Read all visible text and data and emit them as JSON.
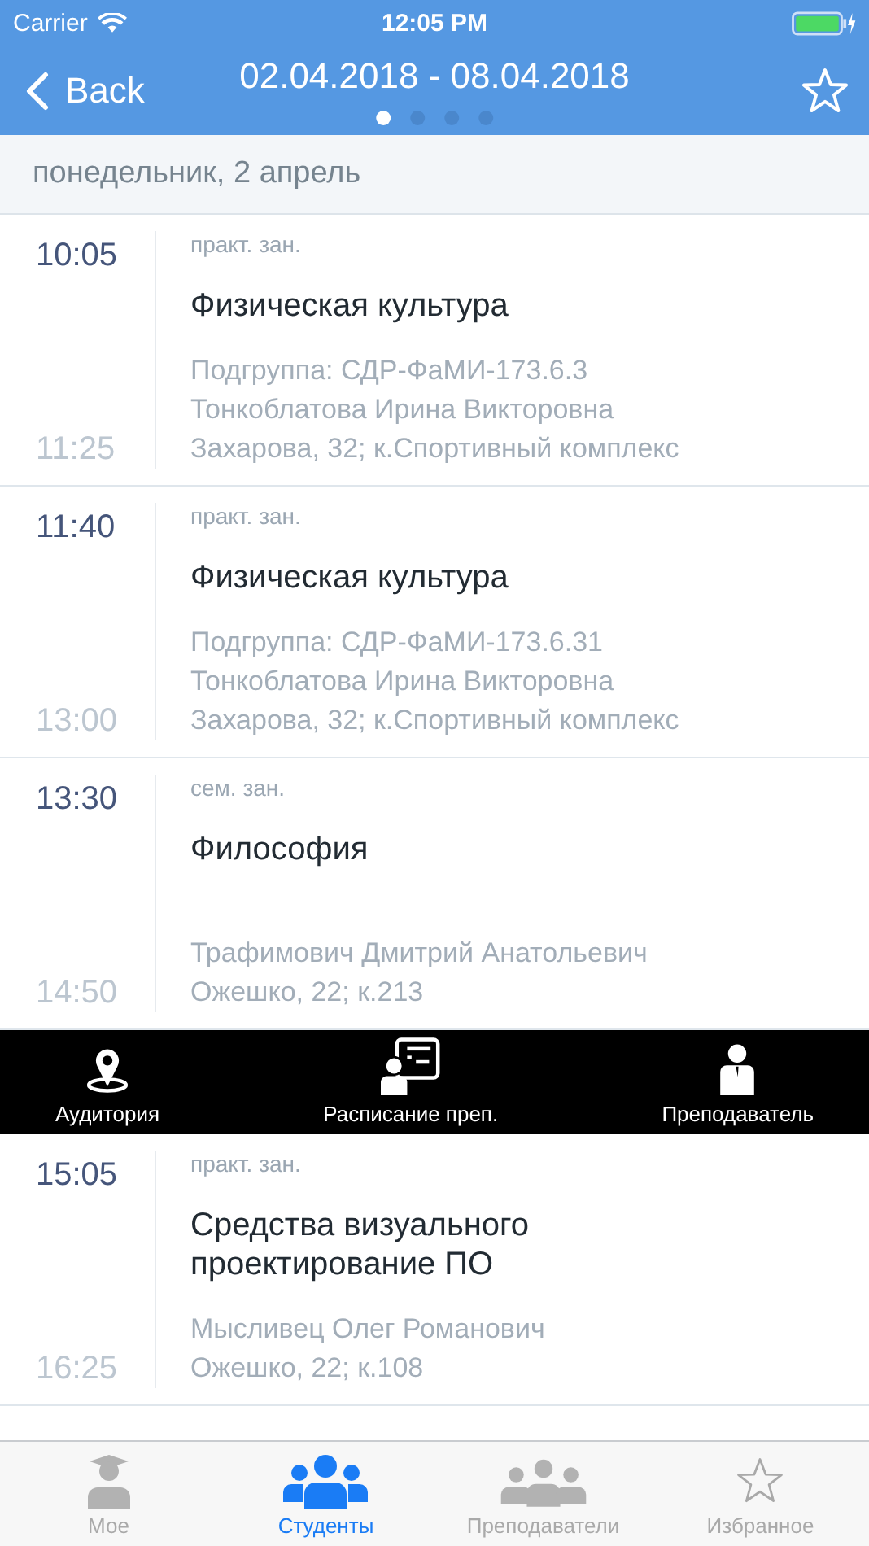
{
  "status_bar": {
    "carrier": "Carrier",
    "time": "12:05 PM"
  },
  "nav_bar": {
    "back": "Back",
    "title": "02.04.2018 - 08.04.2018",
    "pages": [
      {
        "selected": true
      },
      {
        "selected": false
      },
      {
        "selected": false
      },
      {
        "selected": false
      }
    ]
  },
  "day_header": "понедельник, 2 апрель",
  "lessons": [
    {
      "start": "10:05",
      "end": "11:25",
      "type": "практ. зан.",
      "title": "Физическая культура",
      "details": [
        "Подгруппа: СДР-ФаМИ-173.6.3",
        "Тонкоблатова Ирина Викторовна",
        "Захарова, 32; к.Спортивный комплекс"
      ]
    },
    {
      "start": "11:40",
      "end": "13:00",
      "type": "практ. зан.",
      "title": "Физическая культура",
      "details": [
        "Подгруппа: СДР-ФаМИ-173.6.31",
        "Тонкоблатова Ирина Викторовна",
        "Захарова, 32; к.Спортивный комплекс"
      ]
    },
    {
      "start": "13:30",
      "end": "14:50",
      "type": "сем. зан.",
      "title": "Философия",
      "details": [
        "Трафимович Дмитрий Анатольевич",
        "Ожешко, 22; к.213"
      ],
      "actions": [
        {
          "kind": "location",
          "label": "Аудитория"
        },
        {
          "kind": "schedule",
          "label": "Расписание преп."
        },
        {
          "kind": "teacher",
          "label": "Преподаватель"
        }
      ]
    },
    {
      "start": "15:05",
      "end": "16:25",
      "type": "практ. зан.",
      "title": "Средства визуального проектирование ПО",
      "details": [
        "Мысливец Олег Романович",
        "Ожешко, 22; к.108"
      ]
    }
  ],
  "tab_bar": [
    {
      "kind": "mine",
      "label": "Мое",
      "selected": false
    },
    {
      "kind": "students",
      "label": "Студенты",
      "selected": true
    },
    {
      "kind": "teachers",
      "label": "Преподаватели",
      "selected": false
    },
    {
      "kind": "favorites",
      "label": "Избранное",
      "selected": false
    }
  ]
}
